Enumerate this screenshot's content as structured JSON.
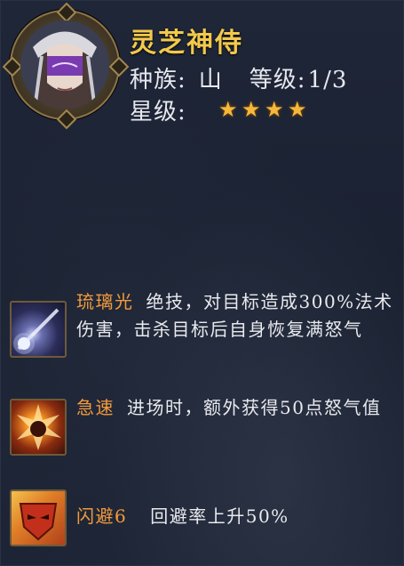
{
  "hero": {
    "name": "灵芝神侍",
    "race_label": "种族:",
    "race_value": "山",
    "level_label": "等级:",
    "level_value": "1/3",
    "star_label": "星级:",
    "star_rating": 4,
    "star_glyph": "★"
  },
  "skills": [
    {
      "name": "琉璃光",
      "description": "绝技，对目标造成300%法术伤害，击杀目标后自身恢复满怒气",
      "icon": "comet-icon"
    },
    {
      "name": "急速",
      "description": "进场时，额外获得50点怒气值",
      "icon": "burst-icon"
    },
    {
      "name": "闪避6",
      "description": "回避率上升50%",
      "icon": "mask-icon"
    }
  ],
  "colors": {
    "title": "#f2c94c",
    "skill_name": "#f39a3a",
    "text": "#e9eaee",
    "star": "#f5b83a",
    "background": "#1b2233"
  }
}
